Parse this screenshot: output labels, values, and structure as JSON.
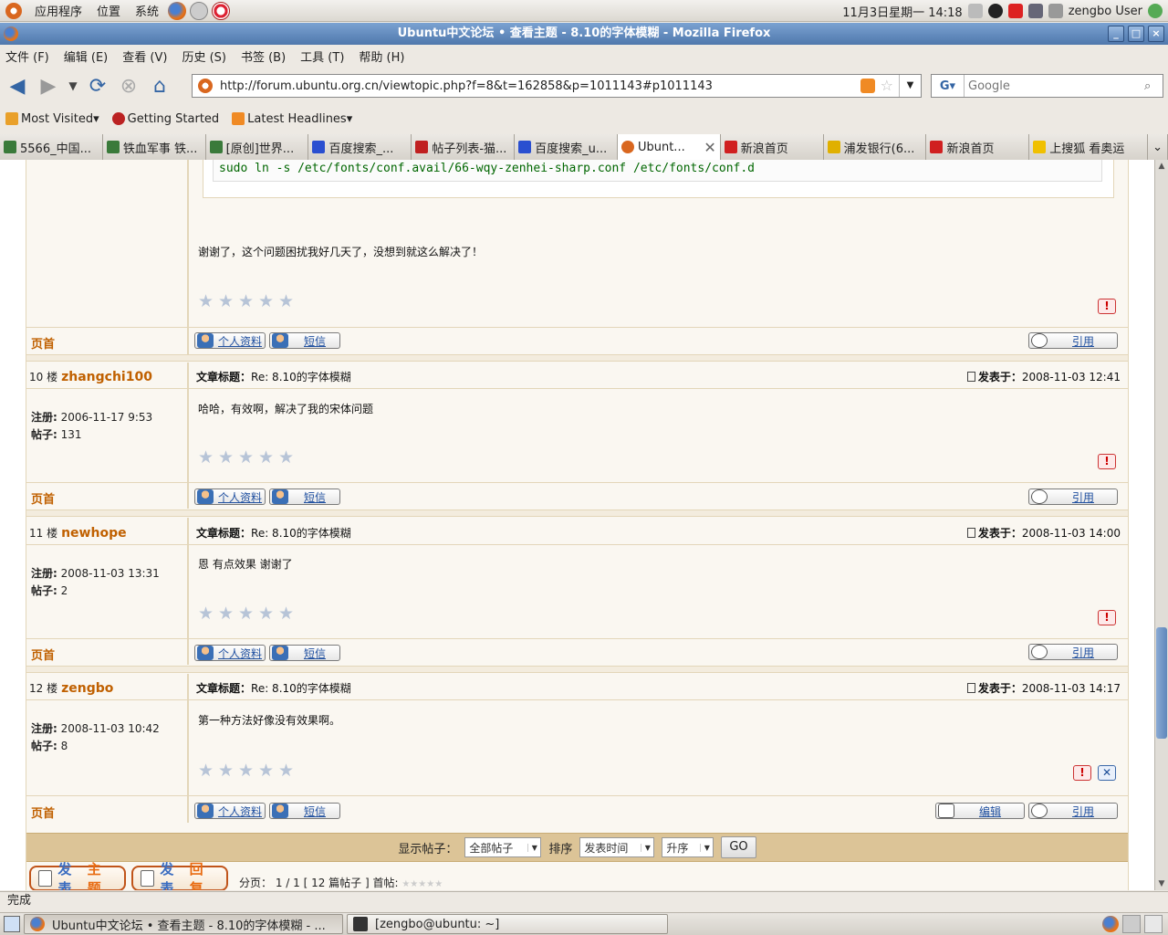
{
  "top_panel": {
    "menus": [
      "应用程序",
      "位置",
      "系统"
    ],
    "datetime": "11月3日星期一  14:18",
    "user": "zengbo User"
  },
  "window": {
    "title": "Ubuntu中文论坛 • 查看主题 - 8.10的字体模糊 - Mozilla Firefox"
  },
  "menu_bar": [
    "文件 (F)",
    "编辑 (E)",
    "查看 (V)",
    "历史 (S)",
    "书签 (B)",
    "工具 (T)",
    "帮助 (H)"
  ],
  "nav": {
    "url": "http://forum.ubuntu.org.cn/viewtopic.php?f=8&t=162858&p=1011143#p1011143",
    "search_placeholder": "Google"
  },
  "bookmarks": [
    "Most Visited",
    "Getting Started",
    "Latest Headlines"
  ],
  "tabs": [
    {
      "label": "5566_中国...",
      "color": "#3a7a3a"
    },
    {
      "label": "铁血军事 铁...",
      "color": "#3a7a3a"
    },
    {
      "label": "[原创]世界...",
      "color": "#3a7a3a"
    },
    {
      "label": "百度搜索_...",
      "color": "#2a4fd0"
    },
    {
      "label": "帖子列表-猫...",
      "color": "#c02020"
    },
    {
      "label": "百度搜索_u...",
      "color": "#2a4fd0"
    },
    {
      "label": "Ubunt...",
      "color": "#d9671f"
    },
    {
      "label": "新浪首页",
      "color": "#d02020"
    },
    {
      "label": "浦发银行(6...",
      "color": "#e0b000"
    },
    {
      "label": "新浪首页",
      "color": "#d02020"
    },
    {
      "label": "上搜狐 看奥运",
      "color": "#f0c000"
    }
  ],
  "code_line": "sudo ln -s /etc/fonts/conf.avail/66-wqy-zenhei-sharp.conf  /etc/fonts/conf.d",
  "labels": {
    "top_link": "页首",
    "profile_btn": "个人资料",
    "pm_btn": "短信",
    "quote_btn": "引用",
    "edit_btn": "编辑",
    "subject_label": "文章标题：",
    "posted_label": "发表于：",
    "reg_label": "注册:",
    "posts_label": "帖子:"
  },
  "post9": {
    "text": "谢谢了，这个问题困扰我好几天了，没想到就这么解决了！"
  },
  "posts": [
    {
      "floor": "10 楼",
      "user": "zhangchi100",
      "subject": "Re: 8.10的字体模糊",
      "time": "2008-11-03 12:41",
      "reg": "2006-11-17 9:53",
      "count": "131",
      "text": "哈哈，有效啊，解决了我的宋体问题"
    },
    {
      "floor": "11 楼",
      "user": "newhope",
      "subject": "Re: 8.10的字体模糊",
      "time": "2008-11-03 14:00",
      "reg": "2008-11-03 13:31",
      "count": "2",
      "text": "恩 有点效果 谢谢了"
    },
    {
      "floor": "12 楼",
      "user": "zengbo",
      "subject": "Re: 8.10的字体模糊",
      "time": "2008-11-03 14:17",
      "reg": "2008-11-03 10:42",
      "count": "8",
      "text": "第一种方法好像没有效果啊。"
    }
  ],
  "sort_bar": {
    "show_label": "显示帖子：",
    "show_value": "全部帖子",
    "sort_label": "排序",
    "sort_value": "发表时间",
    "order_value": "升序",
    "go": "GO"
  },
  "actions": {
    "new_topic_a": "发表",
    "new_topic_b": "主题",
    "reply_a": "发表",
    "reply_b": "回复"
  },
  "pager": {
    "text": "分页：  1 / 1  [ 12 篇帖子 ] 首帖:"
  },
  "status": "完成",
  "taskbar": [
    "Ubuntu中文论坛 • 查看主题 - 8.10的字体模糊 - ...",
    "[zengbo@ubuntu: ~]"
  ]
}
